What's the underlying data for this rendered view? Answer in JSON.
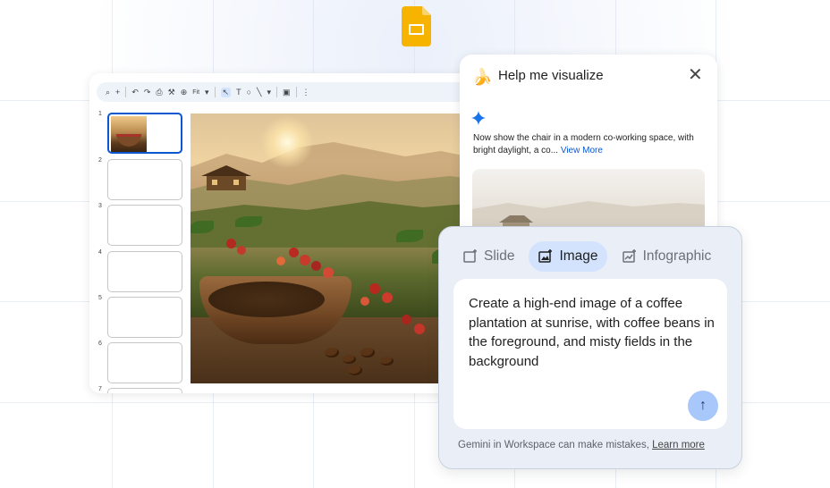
{
  "toolbar": {
    "zoom_label": "Fit"
  },
  "filmstrip": {
    "slides": [
      "1",
      "2",
      "3",
      "4",
      "5",
      "6",
      "7"
    ]
  },
  "viz_panel": {
    "title": "Help me visualize",
    "prompt_text": "Now show the chair in a modern co-working space, with bright daylight, a co...",
    "view_more": "View More"
  },
  "composer": {
    "tabs": [
      {
        "label": "Slide",
        "icon": "slide-add-icon"
      },
      {
        "label": "Image",
        "icon": "image-add-icon"
      },
      {
        "label": "Infographic",
        "icon": "chart-add-icon"
      }
    ],
    "input_text": "Create a high-end image of a coffee plantation at sunrise, with coffee beans in the foreground, and misty fields in the background",
    "disclaimer": "Gemini in Workspace can make mistakes,",
    "learn_more": "Learn more"
  },
  "colors": {
    "accent": "#0b57d0",
    "active_tab": "#d3e3fd",
    "send_button": "#a8c7fa",
    "slides_logo": "#f6b400"
  }
}
